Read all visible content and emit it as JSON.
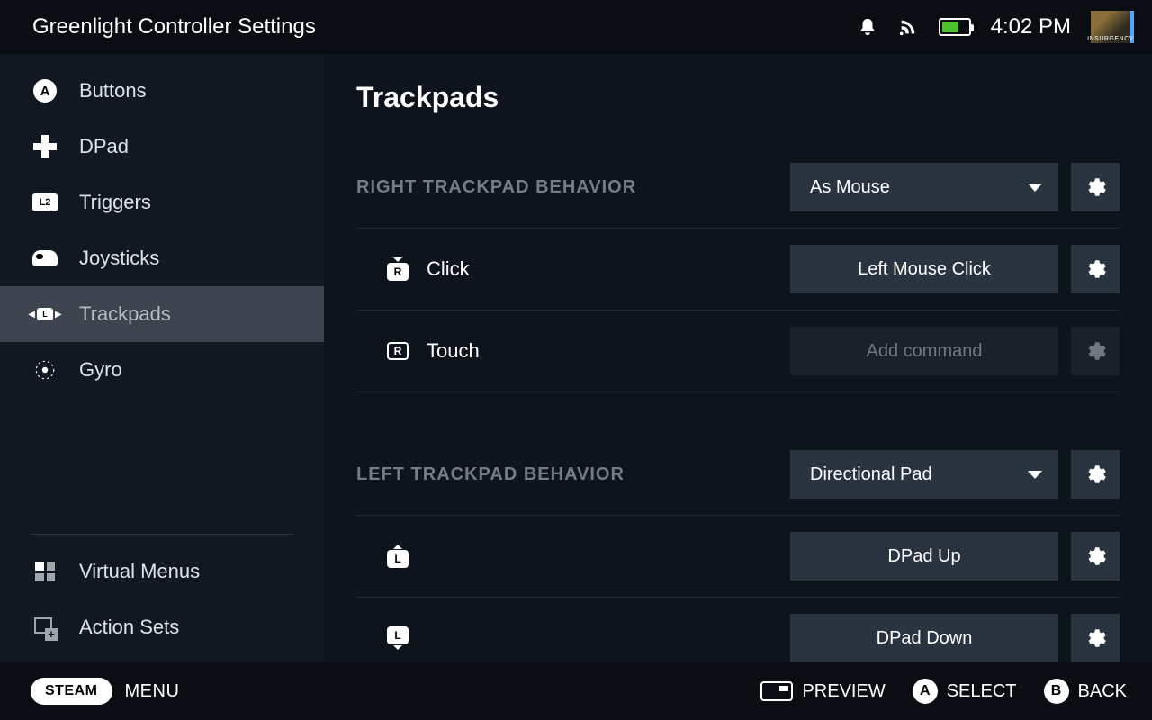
{
  "header": {
    "title": "Greenlight Controller Settings",
    "time": "4:02 PM",
    "avatar_label": "INSURGENCY"
  },
  "sidebar": {
    "items": [
      {
        "label": "Buttons"
      },
      {
        "label": "DPad"
      },
      {
        "label": "Triggers",
        "badge": "L2"
      },
      {
        "label": "Joysticks"
      },
      {
        "label": "Trackpads",
        "badge": "L"
      },
      {
        "label": "Gyro"
      }
    ],
    "lower": [
      {
        "label": "Virtual Menus"
      },
      {
        "label": "Action Sets"
      }
    ]
  },
  "main": {
    "title": "Trackpads",
    "right": {
      "header": "RIGHT TRACKPAD BEHAVIOR",
      "behavior": "As Mouse",
      "click_label": "Click",
      "click_binding": "Left Mouse Click",
      "touch_label": "Touch",
      "touch_binding": "Add command",
      "glyph": "R"
    },
    "left": {
      "header": "LEFT TRACKPAD BEHAVIOR",
      "behavior": "Directional Pad",
      "up_binding": "DPad Up",
      "down_binding": "DPad Down",
      "glyph": "L"
    }
  },
  "footer": {
    "steam": "STEAM",
    "menu": "MENU",
    "preview": "PREVIEW",
    "select": "SELECT",
    "back": "BACK",
    "a_glyph": "A",
    "b_glyph": "B"
  }
}
